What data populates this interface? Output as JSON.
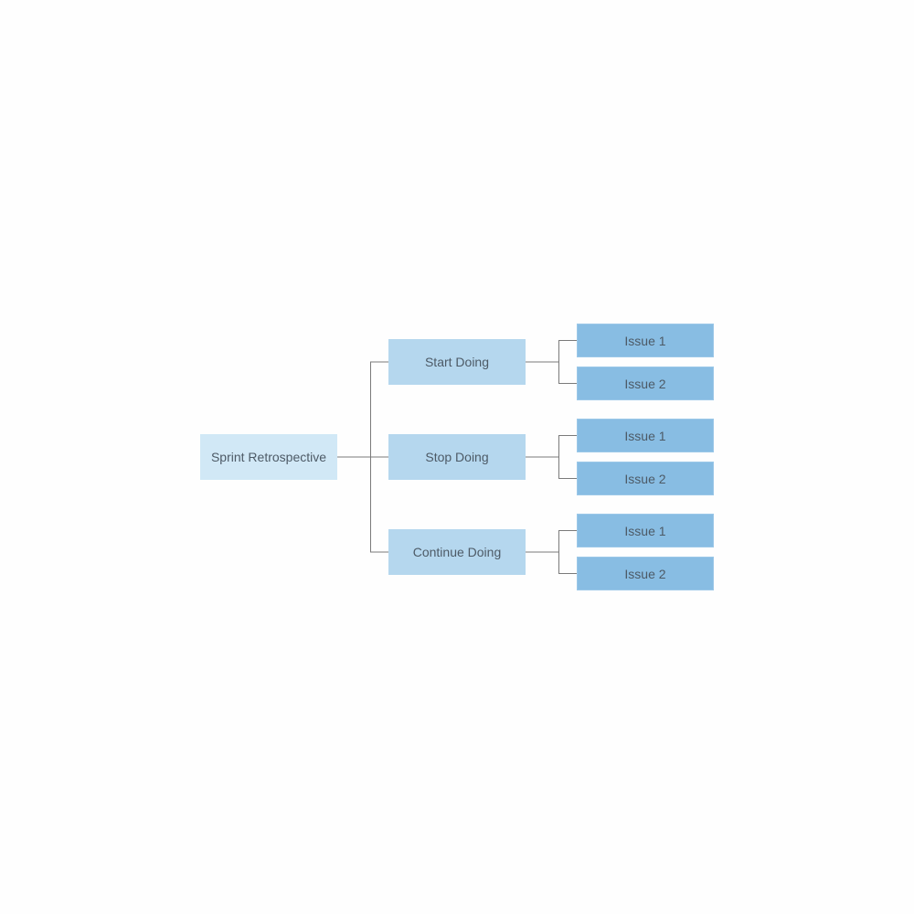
{
  "diagram": {
    "type": "tree",
    "root": {
      "label": "Sprint Retrospective"
    },
    "branches": [
      {
        "label": "Start Doing",
        "children": [
          {
            "label": "Issue 1"
          },
          {
            "label": "Issue 2"
          }
        ]
      },
      {
        "label": "Stop Doing",
        "children": [
          {
            "label": "Issue 1"
          },
          {
            "label": "Issue 2"
          }
        ]
      },
      {
        "label": "Continue Doing",
        "children": [
          {
            "label": "Issue 1"
          },
          {
            "label": "Issue 2"
          }
        ]
      }
    ],
    "colors": {
      "root": "#d1e8f6",
      "branch": "#b5d7ee",
      "leaf": "#88bde3",
      "connector": "#7a7a7a",
      "text": "#4d5a66"
    }
  }
}
